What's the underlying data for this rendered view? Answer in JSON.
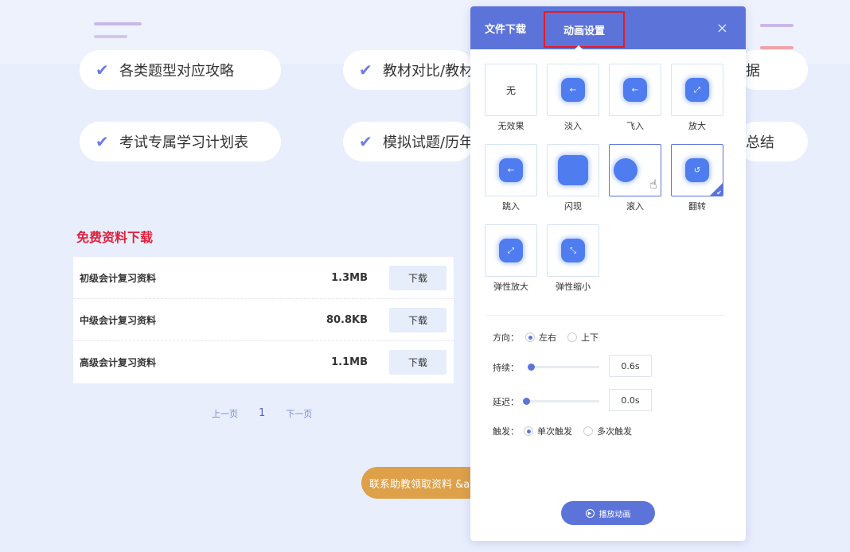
{
  "background": {
    "features": [
      {
        "label": "各类题型对应攻略"
      },
      {
        "label": "教材对比/教材"
      },
      {
        "label": "据"
      },
      {
        "label": "考试专属学习计划表"
      },
      {
        "label": "模拟试题/历年"
      },
      {
        "label": "总结"
      }
    ],
    "section_title": "免费资料下载",
    "downloads": [
      {
        "name": "初级会计复习资料",
        "size": "1.3MB",
        "button": "下载"
      },
      {
        "name": "中级会计复习资料",
        "size": "80.8KB",
        "button": "下载"
      },
      {
        "name": "高级会计复习资料",
        "size": "1.1MB",
        "button": "下载"
      }
    ],
    "pager": {
      "prev": "上一页",
      "current": "1",
      "next": "下一页"
    },
    "contact_button": "联系助教领取资料 &a"
  },
  "panel": {
    "tabs": [
      {
        "label": "文件下载"
      },
      {
        "label": "动画设置"
      }
    ],
    "close_glyph": "×",
    "effects": [
      {
        "label": "无效果",
        "inner": "无"
      },
      {
        "label": "淡入",
        "inner": "←"
      },
      {
        "label": "飞入",
        "inner": "←"
      },
      {
        "label": "放大",
        "inner": "⤢"
      },
      {
        "label": "跳入",
        "inner": "←"
      },
      {
        "label": "闪现",
        "inner": ""
      },
      {
        "label": "滚入",
        "inner": ""
      },
      {
        "label": "翻转",
        "inner": "↺"
      },
      {
        "label": "弹性放大",
        "inner": "⤢"
      },
      {
        "label": "弹性缩小",
        "inner": "⤡"
      }
    ],
    "selected_effect": "翻转",
    "direction": {
      "label": "方向：",
      "options": [
        "左右",
        "上下"
      ],
      "selected": "左右"
    },
    "duration": {
      "label": "持续：",
      "value": "0.6s"
    },
    "delay": {
      "label": "延迟：",
      "value": "0.0s"
    },
    "trigger": {
      "label": "触发：",
      "options": [
        "单次触发",
        "多次触发"
      ],
      "selected": "单次触发"
    },
    "play_button": "播放动画",
    "accent": "#5c74da"
  }
}
